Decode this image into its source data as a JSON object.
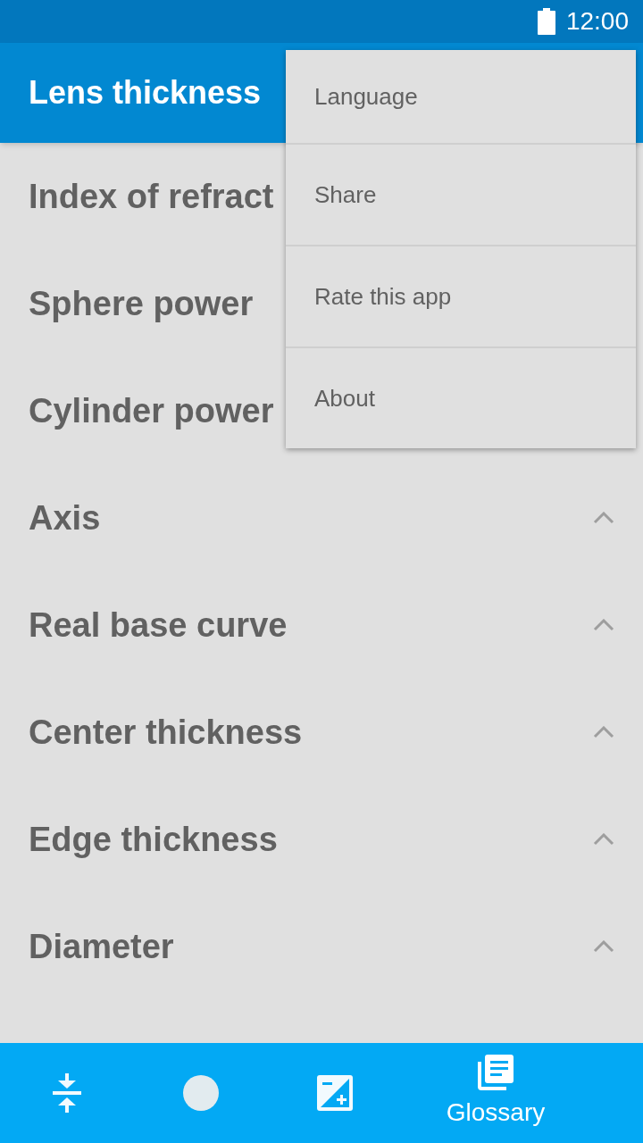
{
  "status_bar": {
    "time": "12:00"
  },
  "app_bar": {
    "title": "Lens thickness"
  },
  "rows": [
    {
      "label": "Index of refract"
    },
    {
      "label": "Sphere power"
    },
    {
      "label": "Cylinder power"
    },
    {
      "label": "Axis"
    },
    {
      "label": "Real base curve"
    },
    {
      "label": "Center thickness"
    },
    {
      "label": "Edge thickness"
    },
    {
      "label": "Diameter"
    }
  ],
  "menu": {
    "items": [
      "Language",
      "Share",
      "Rate this app",
      "About"
    ]
  },
  "bottom_nav": [
    {
      "kind": "compress",
      "selected": false
    },
    {
      "kind": "circle",
      "selected": false
    },
    {
      "kind": "exposure",
      "selected": false
    },
    {
      "kind": "glossary",
      "label": "Glossary",
      "selected": true
    }
  ]
}
